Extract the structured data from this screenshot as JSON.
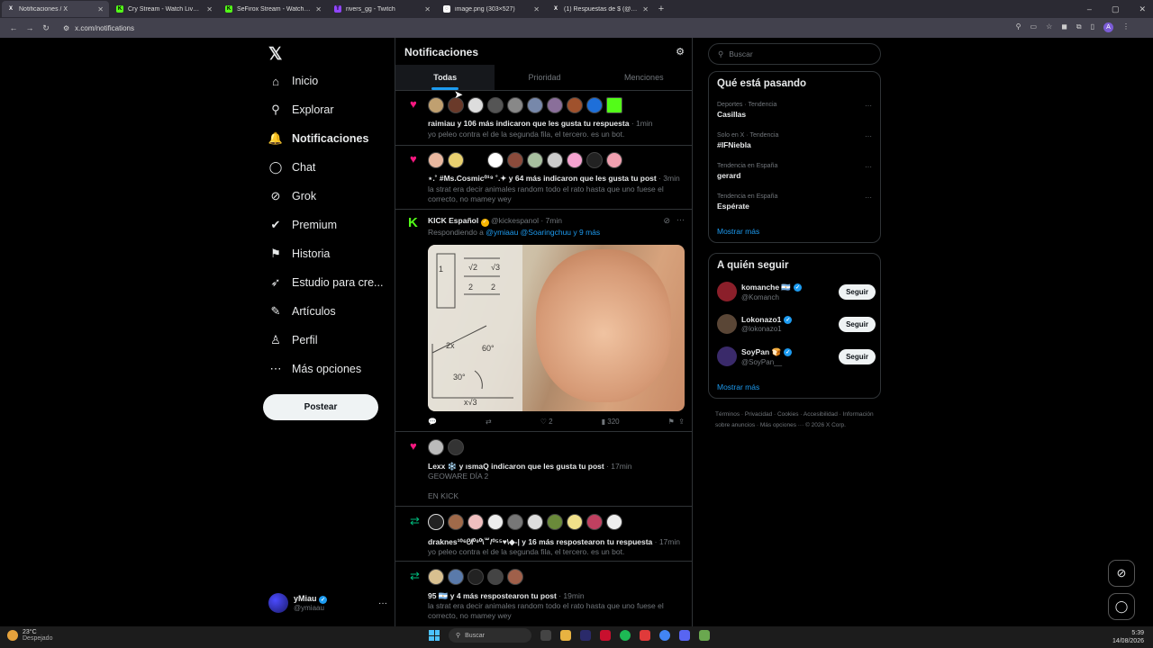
{
  "browser": {
    "tabs": [
      {
        "title": "Notificaciones / X",
        "icon": "X",
        "active": true
      },
      {
        "title": "Cry Stream - Watch Live on Kick",
        "icon": "K"
      },
      {
        "title": "SeFirox Stream - Watch Live on Kick",
        "icon": "K"
      },
      {
        "title": "rivers_gg - Twitch",
        "icon": "T"
      },
      {
        "title": "image.png (303×527)",
        "icon": "◌"
      },
      {
        "title": "(1) Respuestas de $ (@SeFiroc...",
        "icon": "X"
      }
    ],
    "url": "x.com/notifications",
    "profile_letter": "A"
  },
  "nav": {
    "items": [
      {
        "label": "Inicio",
        "icon": "⌂"
      },
      {
        "label": "Explorar",
        "icon": "⚲"
      },
      {
        "label": "Notificaciones",
        "icon": "🔔"
      },
      {
        "label": "Chat",
        "icon": "◯"
      },
      {
        "label": "Grok",
        "icon": "⊘"
      },
      {
        "label": "Premium",
        "icon": "✔"
      },
      {
        "label": "Historia",
        "icon": "⚑"
      },
      {
        "label": "Estudio para cre...",
        "icon": "➶"
      },
      {
        "label": "Artículos",
        "icon": "✎"
      },
      {
        "label": "Perfil",
        "icon": "♙"
      },
      {
        "label": "Más opciones",
        "icon": "⋯"
      }
    ],
    "post_label": "Postear",
    "account": {
      "name": "yMiau",
      "handle": "@ymiaau"
    }
  },
  "main": {
    "title": "Notificaciones",
    "tabs": [
      "Todas",
      "Prioridad",
      "Menciones"
    ],
    "n1": {
      "bold": "raimiau y 106 más indicaron que les gusta tu respuesta",
      "time": " · 1min",
      "text": "yo peleo contra el de la segunda fila, el tercero. es un bot."
    },
    "n2": {
      "bold": "⋆.˚ #Ms.Cosmic⁰¹⁹ ˚.✦ y 64 más indicaron que les gusta tu post",
      "time": " · 3min",
      "text": "la strat era decir animales random todo el rato hasta que uno fuese el correcto, no mamey wey"
    },
    "n3": {
      "name": "KICK Español",
      "handle": "@kickespanol",
      "time": " · 7min",
      "reply_prefix": "Respondiendo a ",
      "reply_to": "@ymiaau @Soaringchuu y 9 más",
      "likes": "2",
      "views": "320"
    },
    "n4": {
      "bold": "Lexx ❄️ y ısmaQ indicaron que les gusta tu post",
      "time": " · 17min",
      "line1": "GEOWARE DÍA 2",
      "line2": "EN KICK"
    },
    "n5": {
      "bold": "draknes¹⁰⁶ᘛ⁰⁹⁰\\꒳/⁰⁵⁵♥\\◆-| y 16 más respostearon tu respuesta",
      "time": " · 17min",
      "text": "yo peleo contra el de la segunda fila, el tercero. es un bot."
    },
    "n6": {
      "bold": "95 🇦🇷 y 4 más respostearon tu post",
      "time": " · 19min",
      "text": "la strat era decir animales random todo el rato hasta que uno fuese el correcto, no mamey wey"
    }
  },
  "sidebar": {
    "search_placeholder": "Buscar",
    "trending_title": "Qué está pasando",
    "trends": [
      {
        "category": "Deportes · Tendencia",
        "name": "Casillas"
      },
      {
        "category": "Solo en X · Tendencia",
        "name": "#IFNiebla"
      },
      {
        "category": "Tendencia en España",
        "name": "gerard"
      },
      {
        "category": "Tendencia en España",
        "name": "Espérate"
      }
    ],
    "show_more": "Mostrar más",
    "follow_title": "A quién seguir",
    "follow": [
      {
        "name": "komanche 🇦🇷",
        "handle": "@Komanch",
        "color": "#8b1f2a"
      },
      {
        "name": "Lokonazo1",
        "handle": "@lokonazo1",
        "color": "#5a4636"
      },
      {
        "name": "SoyPan 🍞",
        "handle": "@SoyPan__",
        "color": "#3a2a6a"
      }
    ],
    "follow_label": "Seguir",
    "footer": "Términos · Privacidad · Cookies · Accesibilidad · Información sobre anuncios · Más opciones ··· © 2026 X Corp."
  },
  "taskbar": {
    "temp": "23°C",
    "weather": "Despejado",
    "search": "Buscar",
    "time": "5:39",
    "date": "14/08/2026"
  }
}
